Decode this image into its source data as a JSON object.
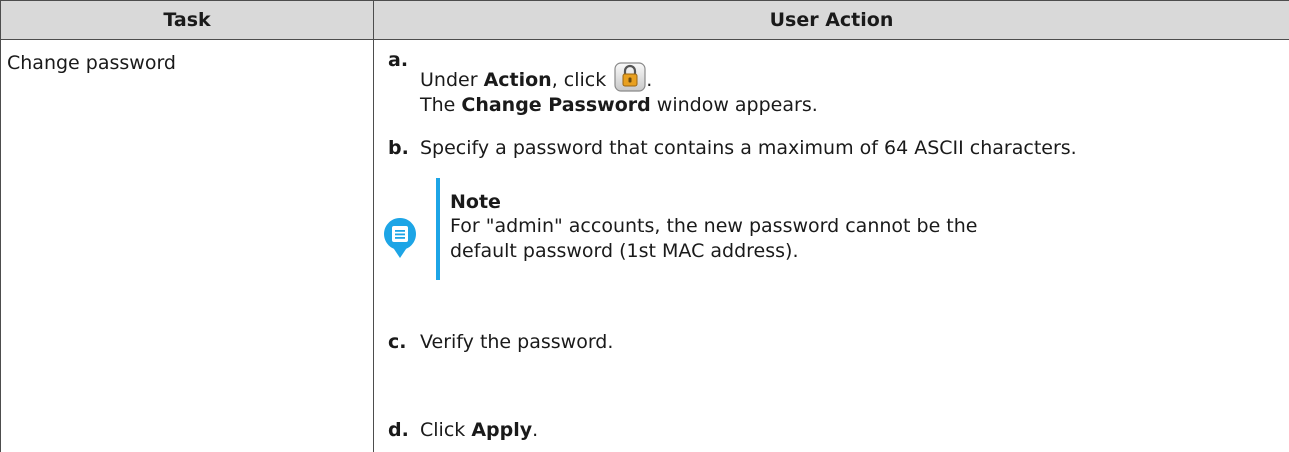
{
  "table": {
    "headers": {
      "task": "Task",
      "user_action": "User Action"
    },
    "row": {
      "task": "Change password",
      "steps": {
        "a": {
          "letter": "a.",
          "pre": "Under ",
          "bold": "Action",
          "mid": ", click ",
          "post": ".",
          "line2_pre": "The ",
          "line2_bold": "Change Password",
          "line2_post": " window appears.",
          "icon": "lock-icon"
        },
        "b": {
          "letter": "b.",
          "text": "Specify a password that contains a maximum of 64 ASCII characters."
        },
        "c": {
          "letter": "c.",
          "text": "Verify the password."
        },
        "d": {
          "letter": "d.",
          "pre": "Click ",
          "bold": "Apply",
          "post": "."
        }
      },
      "note": {
        "icon": "note-icon",
        "title": "Note",
        "text": "For \"admin\" accounts, the new password cannot be the default password (1st MAC address)."
      }
    }
  },
  "colors": {
    "header_bg": "#d9d9d9",
    "border": "#4d4d4d",
    "note_accent": "#1da5e6",
    "icon_gold": "#e8a020"
  }
}
